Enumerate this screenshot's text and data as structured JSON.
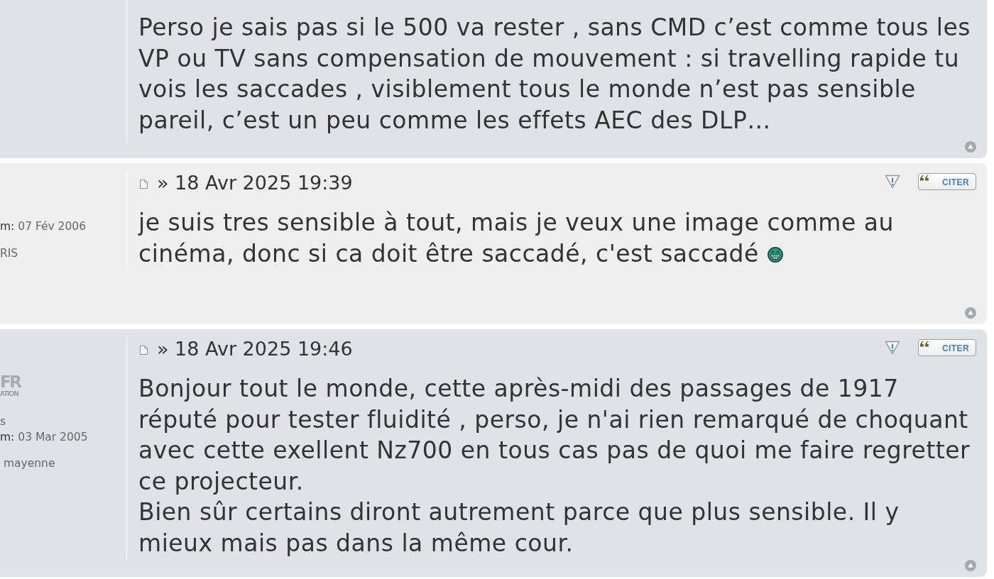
{
  "posts": [
    {
      "color": "#dfe3e8",
      "body": {
        "lines": [
          "Perso je sais pas si le 500 va rester , sans CMD c’est comme tous les",
          "VP ou TV sans compensation de mouvement : si travelling rapide tu",
          "vois les saccades , visiblement tous le monde n’est pas sensible",
          "pareil, c’est un peu comme les effets AEC des DLP…"
        ]
      }
    },
    {
      "color": "#efefef",
      "profile": {
        "lines": [
          {
            "label": "m:",
            "value": "07 Fév 2006"
          },
          {
            "value": "RIS"
          }
        ]
      },
      "header": {
        "date": "» 18 Avr 2025 19:39",
        "quote_button": "CITER"
      },
      "body": {
        "lines": [
          "je suis tres sensible à tout, mais je veux une image comme au",
          "cinéma, donc si ca doit être saccadé, c'est saccadé"
        ],
        "smiley": true
      }
    },
    {
      "color": "#dfe3e8",
      "profile": {
        "rank_logo": {
          "big": "FR",
          "small": "ATION"
        },
        "lines": [
          {
            "value": "s"
          },
          {
            "label": "m:",
            "value": "03 Mar 2005"
          },
          {
            "value": " mayenne"
          }
        ]
      },
      "header": {
        "date": "» 18 Avr 2025 19:46",
        "quote_button": "CITER"
      },
      "body": {
        "lines": [
          "Bonjour tout le monde, cette après-midi des passages de 1917",
          "réputé pour tester fluidité , perso, je n'ai rien remarqué de choquant",
          "avec cette exellent Nz700 en tous cas pas de quoi me faire regretter",
          "ce projecteur.",
          "Bien sûr certains diront autrement parce que plus sensible. Il y",
          "mieux mais pas dans la même cour."
        ]
      }
    }
  ]
}
